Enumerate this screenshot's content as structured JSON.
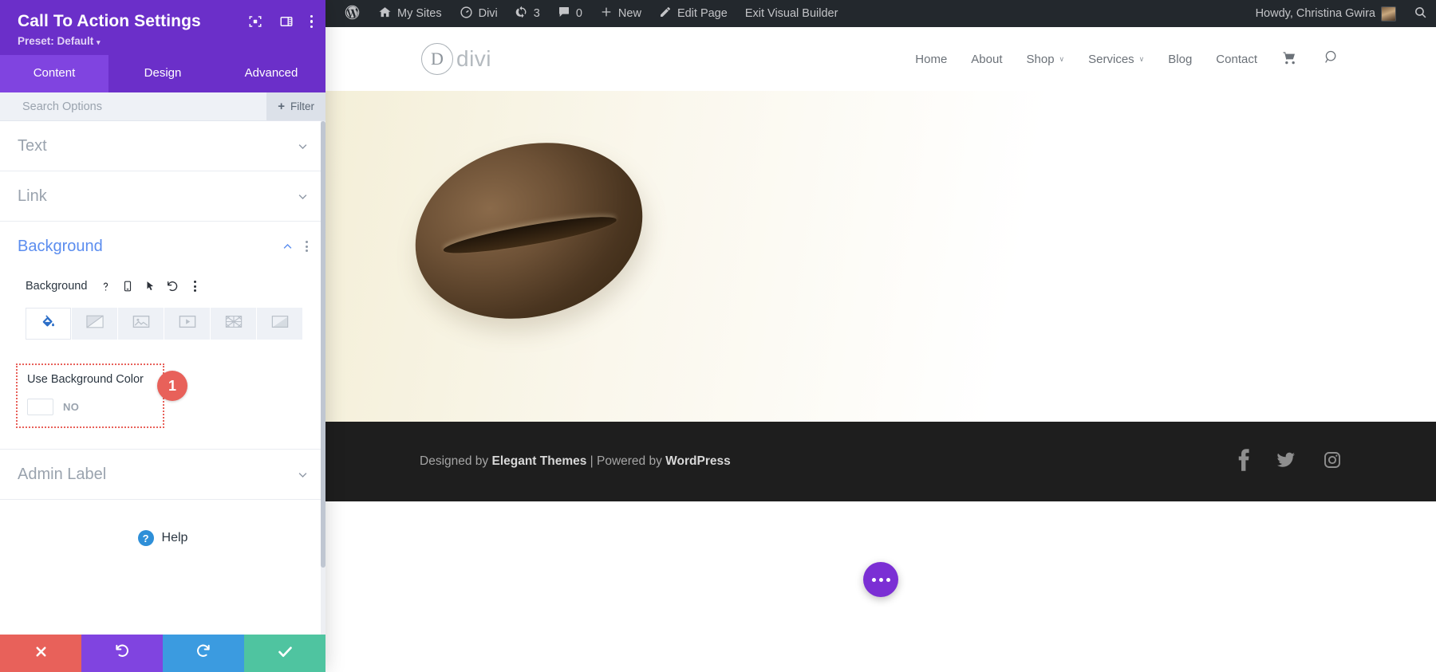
{
  "panel": {
    "title": "Call To Action Settings",
    "preset_label": "Preset: Default",
    "preset_caret": "▾",
    "head_icons": [
      "focus-icon",
      "layout-panel-icon",
      "more-options-icon"
    ],
    "tabs": [
      {
        "label": "Content",
        "active": true
      },
      {
        "label": "Design",
        "active": false
      },
      {
        "label": "Advanced",
        "active": false
      }
    ],
    "search": {
      "value": "",
      "placeholder": "Search Options"
    },
    "filter_button": {
      "label": "Filter",
      "plus": "+"
    },
    "sections": [
      {
        "label": "Text",
        "open": false
      },
      {
        "label": "Link",
        "open": false
      },
      {
        "label": "Background",
        "open": true
      },
      {
        "label": "Admin Label",
        "open": false
      }
    ],
    "background": {
      "field_label": "Background",
      "field_icons": [
        "help-icon",
        "responsive-phone-icon",
        "hover-cursor-icon",
        "reset-undo-icon",
        "more-options-icon"
      ],
      "type_tabs": [
        {
          "name": "background-color-tab",
          "icon": "paint-bucket-icon",
          "active": true
        },
        {
          "name": "background-gradient-tab",
          "icon": "gradient-icon",
          "active": false
        },
        {
          "name": "background-image-tab",
          "icon": "image-icon",
          "active": false
        },
        {
          "name": "background-video-tab",
          "icon": "video-icon",
          "active": false
        },
        {
          "name": "background-pattern-tab",
          "icon": "pattern-icon",
          "active": false
        },
        {
          "name": "background-mask-tab",
          "icon": "mask-icon",
          "active": false
        }
      ],
      "toggle": {
        "label": "Use Background Color",
        "state_text": "NO",
        "value": "off"
      },
      "annotation_badge": "1"
    },
    "help": {
      "label": "Help",
      "badge": "?"
    },
    "footer_buttons": [
      {
        "name": "cancel-button",
        "icon": "close-x-icon",
        "color": "#E8615A"
      },
      {
        "name": "undo-button",
        "icon": "undo-arrow-icon",
        "color": "#8044E0"
      },
      {
        "name": "redo-button",
        "icon": "redo-arrow-icon",
        "color": "#3B9BE0"
      },
      {
        "name": "save-button",
        "icon": "check-icon",
        "color": "#4FC4A0"
      }
    ]
  },
  "adminbar": {
    "wp_logo": "wordpress-logo-icon",
    "items": [
      {
        "label": "My Sites",
        "icon": "sites-house-icon"
      },
      {
        "label": "Divi",
        "icon": "divi-dashboard-icon"
      },
      {
        "label": "3",
        "icon": "updates-refresh-icon"
      },
      {
        "label": "0",
        "icon": "comments-bubble-icon"
      },
      {
        "label": "New",
        "icon": "plus-icon"
      },
      {
        "label": "Edit Page",
        "icon": "pencil-icon"
      },
      {
        "label": "Exit Visual Builder",
        "icon": ""
      }
    ],
    "howdy": "Howdy, Christina Gwira",
    "avatar": "user-avatar",
    "search": "search-icon"
  },
  "site": {
    "logo": {
      "mark": "D",
      "word": "divi"
    },
    "nav": [
      {
        "label": "Home",
        "dropdown": false
      },
      {
        "label": "About",
        "dropdown": false
      },
      {
        "label": "Shop",
        "dropdown": true
      },
      {
        "label": "Services",
        "dropdown": true
      },
      {
        "label": "Blog",
        "dropdown": false
      },
      {
        "label": "Contact",
        "dropdown": false
      }
    ],
    "nav_caret": "∨",
    "cart_icon": "shopping-cart-icon",
    "search_icon": "search-icon",
    "hero_image_alt": "artisan-bread-loaf",
    "footer": {
      "prefix": "Designed by ",
      "brand1": "Elegant Themes",
      "separator": " | ",
      "middle": "Powered by ",
      "brand2": "WordPress",
      "social": [
        "facebook-icon",
        "twitter-icon",
        "instagram-icon"
      ]
    },
    "fab": "page-settings-fab"
  }
}
